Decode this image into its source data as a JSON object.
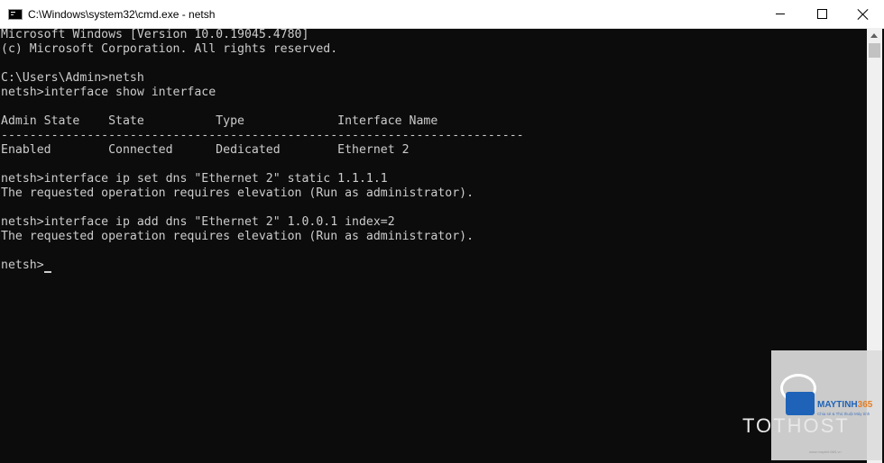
{
  "window": {
    "title": "C:\\Windows\\system32\\cmd.exe - netsh",
    "icon": "cmd-icon"
  },
  "controls": {
    "minimize": "minimize-icon",
    "maximize": "maximize-icon",
    "close": "close-icon"
  },
  "console": {
    "lines": [
      "Microsoft Windows [Version 10.0.19045.4780]",
      "(c) Microsoft Corporation. All rights reserved.",
      "",
      "C:\\Users\\Admin>netsh",
      "netsh>interface show interface",
      "",
      "Admin State    State          Type             Interface Name",
      "-------------------------------------------------------------------------",
      "Enabled        Connected      Dedicated        Ethernet 2",
      "",
      "netsh>interface ip set dns \"Ethernet 2\" static 1.1.1.1",
      "The requested operation requires elevation (Run as administrator).",
      "",
      "netsh>interface ip add dns \"Ethernet 2\" 1.0.0.1 index=2",
      "The requested operation requires elevation (Run as administrator).",
      "",
      "netsh>"
    ]
  },
  "watermark": {
    "brand_main": "MAYTINH",
    "brand_num": "365",
    "tagline": "Chia sẻ & Thủ thuật Máy tính",
    "host": "TOTHOST",
    "url": "www.maytinh365.vn"
  },
  "colors": {
    "console_bg": "#0c0c0c",
    "console_text": "#cccccc",
    "titlebar_bg": "#ffffff",
    "brand_blue": "#1e63b8",
    "brand_orange": "#e67e22"
  }
}
